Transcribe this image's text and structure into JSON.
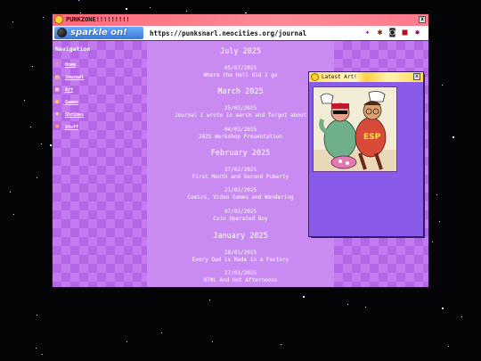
{
  "window": {
    "title": "PUNKZONE!!!!!!!!!",
    "close_label": "x"
  },
  "address_bar": {
    "logo_text": "sparkle on!",
    "url": "https://punksnarl.neocities.org/journal",
    "toolbar_icons": [
      "sparkle-icon",
      "bug-icon",
      "robot-icon",
      "bookmark-icon",
      "beetle-icon"
    ]
  },
  "sidebar": {
    "title": "Navigation",
    "items": [
      {
        "label": "Home",
        "icon": "house-icon"
      },
      {
        "label": "Journal",
        "icon": "book-icon"
      },
      {
        "label": "Art",
        "icon": "palette-icon"
      },
      {
        "label": "Games",
        "icon": "game-icon"
      },
      {
        "label": "Shrines",
        "icon": "shrine-icon"
      },
      {
        "label": "Stuff",
        "icon": "box-icon"
      }
    ]
  },
  "journal": {
    "months": [
      {
        "name": "July 2025",
        "entries": [
          {
            "date": "05/07/2025",
            "title": "Where the hell did I go"
          }
        ]
      },
      {
        "name": "March 2025",
        "entries": [
          {
            "date": "25/03/2025",
            "title": "Journal I wrote in march and forgot about"
          },
          {
            "date": "04/03/2025",
            "title": "2025 Workshop Presentation"
          }
        ]
      },
      {
        "name": "February 2025",
        "entries": [
          {
            "date": "27/02/2025",
            "title": "First Month and Second Puberty"
          },
          {
            "date": "21/02/2025",
            "title": "Comics, Video Games and Wandering"
          },
          {
            "date": "07/02/2025",
            "title": "Coin Operated Boy"
          }
        ]
      },
      {
        "name": "January 2025",
        "entries": [
          {
            "date": "28/01/2025",
            "title": "Every Dad is Made in a Factory"
          },
          {
            "date": "27/01/2025",
            "title": "HTML And Hot Afternoons"
          }
        ]
      }
    ]
  },
  "popup": {
    "title": "Latest Art!",
    "close_label": "x",
    "art_chest_text": "ESP"
  },
  "colors": {
    "titlebar": "#ff7a8c",
    "content_bg": "#c98af2",
    "popup_bg": "#8a5ae8",
    "text": "#ffffff"
  }
}
